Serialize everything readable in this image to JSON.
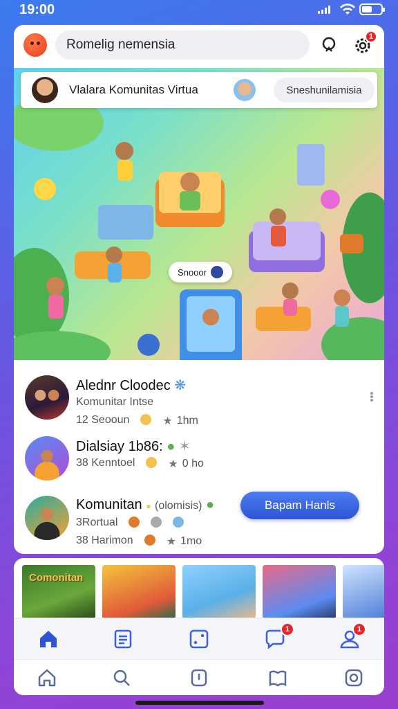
{
  "status": {
    "time": "19:00",
    "battery_level": 0.55
  },
  "header": {
    "search_text": "Romelig nemensia",
    "notification_count": "1"
  },
  "banner": {
    "title": "Vlalara Komunitas Virtua",
    "button_label": "Sneshunilamisia"
  },
  "scene": {
    "pill_label": "Snooor"
  },
  "feed": [
    {
      "title": "Alednr Cloodec",
      "subtitle": "Komunitar Intse",
      "meta1": "12 Seooun",
      "meta2": "1hm"
    },
    {
      "title": "Dialsiay 1b86:",
      "subtitle": "38 Kenntoel",
      "meta1": "0 ho",
      "meta2": ""
    },
    {
      "title": "Komunitan",
      "title_note": "(olomisis)",
      "subtitle": "3Rortual",
      "meta1": "38 Harimon",
      "meta2": "1mo"
    }
  ],
  "cta_label": "Bapam Hanls",
  "thumbnails": [
    {
      "title": "Comonitan"
    },
    {
      "title": ""
    },
    {
      "title": ""
    },
    {
      "title": ""
    },
    {
      "title": ""
    }
  ],
  "tab_badges": {
    "messages": "1",
    "profile": "1"
  },
  "colors": {
    "accent": "#3a5fe0",
    "badge": "#e8262a"
  }
}
